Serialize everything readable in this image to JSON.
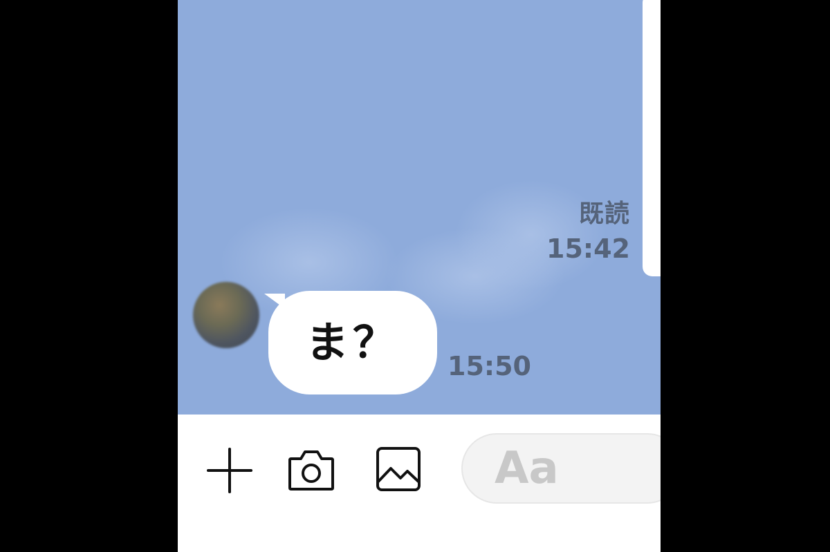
{
  "chat": {
    "sent": {
      "read_label": "既読",
      "time": "15:42"
    },
    "received": {
      "text": "ま？",
      "time": "15:50"
    }
  },
  "input_bar": {
    "placeholder": "Aa",
    "icons": [
      "plus-icon",
      "camera-icon",
      "image-icon"
    ]
  },
  "colors": {
    "chat_background": "#8eabdb",
    "bubble": "#ffffff",
    "timestamp": "#55637a",
    "frame": "#000000"
  }
}
